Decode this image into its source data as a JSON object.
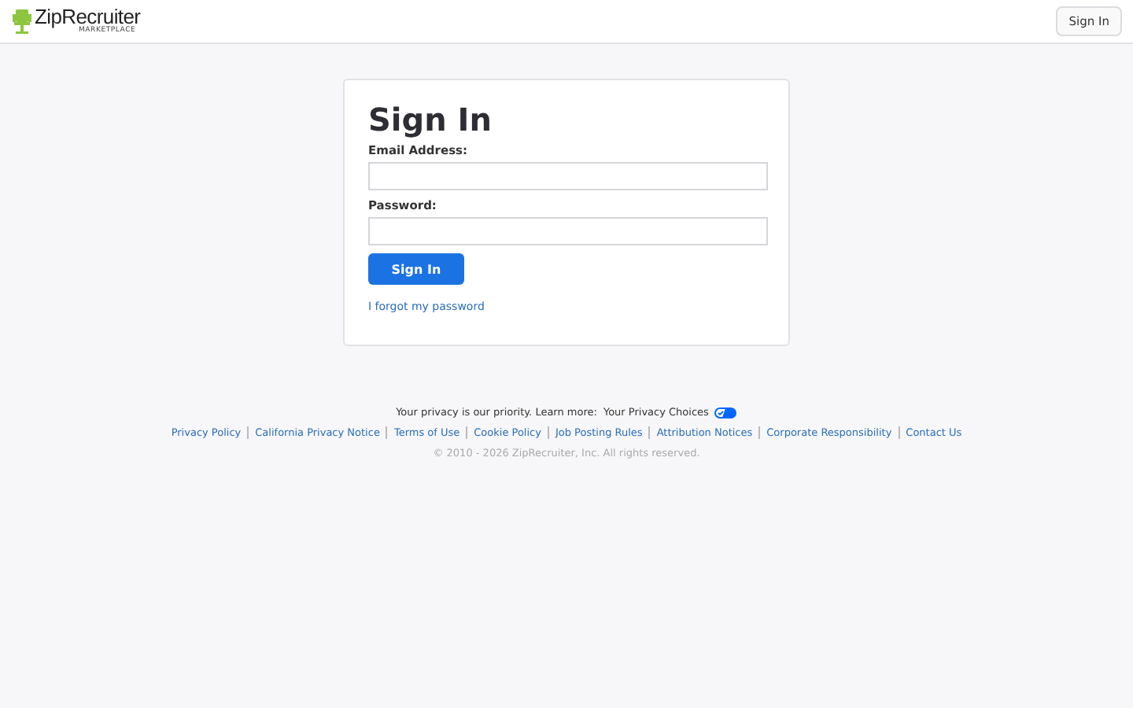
{
  "header": {
    "logo": {
      "name": "ZipRecruiter",
      "tagline": "MARKETPLACE"
    },
    "sign_in_button": "Sign In"
  },
  "form": {
    "title": "Sign In",
    "fields": [
      {
        "label": "Email Address:"
      },
      {
        "label": "Password:"
      }
    ],
    "submit": "Sign In",
    "forgot_link": "I forgot my password"
  },
  "footer": {
    "privacy_text": "Your privacy is our priority. Learn more:",
    "privacy_choices": "Your Privacy Choices",
    "links": [
      "Privacy Policy",
      "California Privacy Notice",
      "Terms of Use",
      "Cookie Policy",
      "Job Posting Rules",
      "Attribution Notices",
      "Corporate Responsibility",
      "Contact Us"
    ],
    "copyright": "© 2010 - 2026 ZipRecruiter, Inc. All rights reserved."
  }
}
